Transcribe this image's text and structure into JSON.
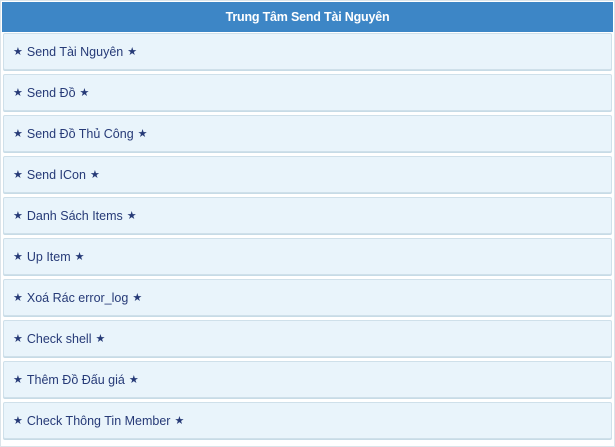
{
  "header": {
    "title": "Trung Tâm Send Tài Nguyên"
  },
  "menu": {
    "star_glyph": "★",
    "items": [
      {
        "label": "Send Tài Nguyên"
      },
      {
        "label": "Send Đồ"
      },
      {
        "label": "Send Đồ Thủ Công"
      },
      {
        "label": "Send ICon"
      },
      {
        "label": "Danh Sách Items"
      },
      {
        "label": "Up Item"
      },
      {
        "label": "Xoá Rác error_log"
      },
      {
        "label": "Check shell"
      },
      {
        "label": "Thêm Đồ Đấu giá"
      },
      {
        "label": "Check Thông Tin Member"
      }
    ]
  }
}
